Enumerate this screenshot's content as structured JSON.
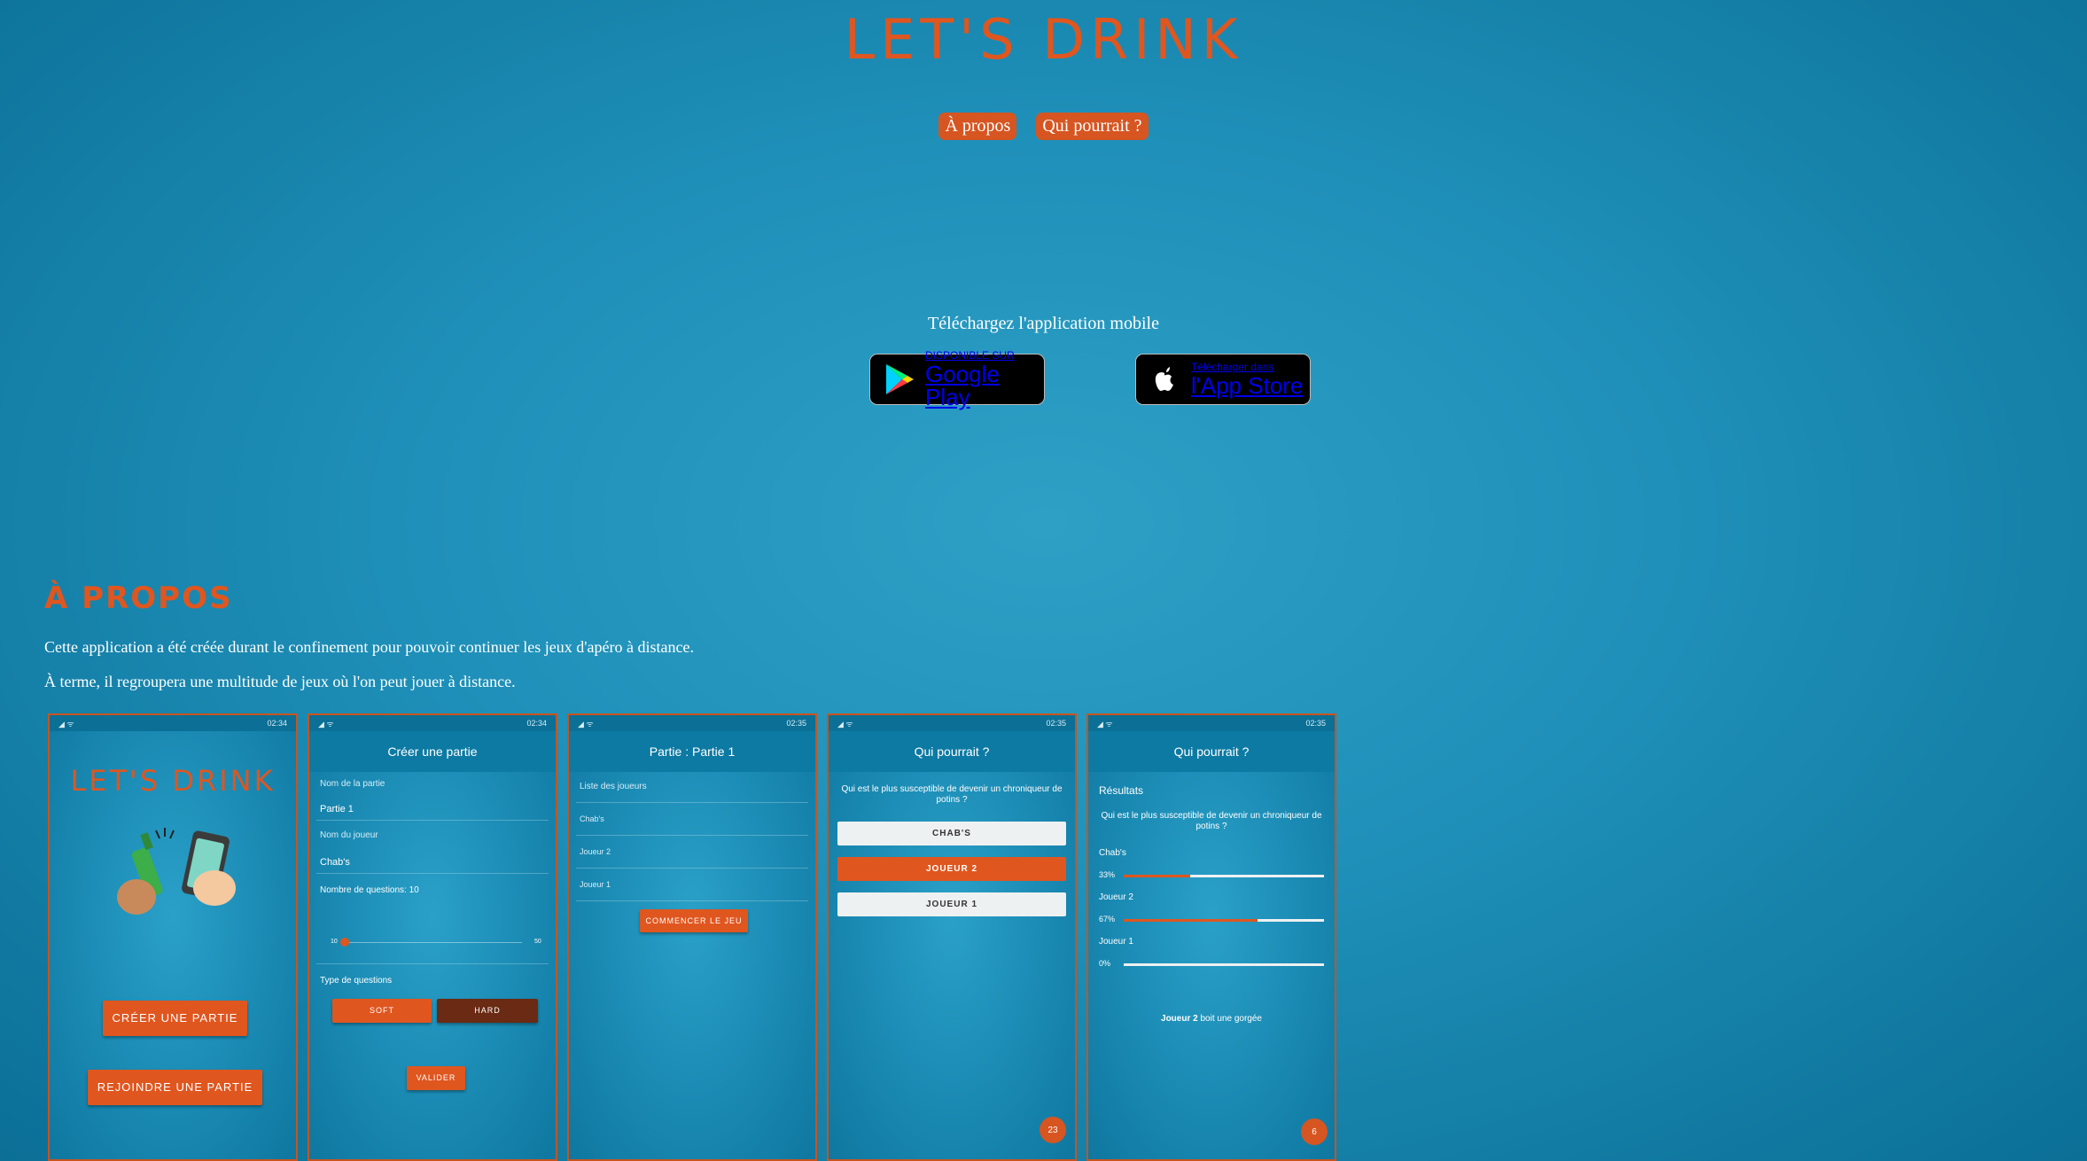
{
  "header": {
    "logo": "LET'S DRINK"
  },
  "nav": {
    "items": [
      {
        "label": "À propos"
      },
      {
        "label": "Qui pourrait ?"
      }
    ]
  },
  "download": {
    "title": "Téléchargez l'application mobile",
    "google": {
      "small": "DISPONIBLE SUR",
      "big": "Google Play",
      "icon": "google-play-icon"
    },
    "apple": {
      "small": "Télécharger dans",
      "big": "l'App Store",
      "icon": "apple-icon"
    }
  },
  "apropos": {
    "title": "À PROPOS",
    "p1": "Cette application a été créée durant le confinement pour pouvoir continuer les jeux d'apéro à distance.",
    "p2": "À terme, il regroupera une multitude de jeux où l'on peut jouer à distance."
  },
  "screens": {
    "s1": {
      "time": "02:34",
      "logo": "LET'S DRINK",
      "btn1": "CRÉER UNE PARTIE",
      "btn2": "REJOINDRE UNE PARTIE"
    },
    "s2": {
      "time": "02:34",
      "title": "Créer une partie",
      "name_label": "Nom de la partie",
      "name_value": "Partie 1",
      "player_label": "Nom du joueur",
      "player_value": "Chab's",
      "questions_label": "Nombre de questions: 10",
      "slider_min": "10",
      "slider_max": "50",
      "type_label": "Type de questions",
      "soft": "SOFT",
      "hard": "HARD",
      "validate": "VALIDER"
    },
    "s3": {
      "time": "02:35",
      "title": "Partie : Partie 1",
      "list_label": "Liste des joueurs",
      "players": [
        "Chab's",
        "Joueur 2",
        "Joueur 1"
      ],
      "start": "COMMENCER LE JEU"
    },
    "s4": {
      "time": "02:35",
      "title": "Qui pourrait ?",
      "question": "Qui est le plus susceptible de devenir un chroniqueur de potins ?",
      "options": [
        "CHAB'S",
        "JOUEUR 2",
        "JOUEUR 1"
      ],
      "badge": "23"
    },
    "s5": {
      "time": "02:35",
      "title": "Qui pourrait ?",
      "results_label": "Résultats",
      "question": "Qui est le plus susceptible de devenir un chroniqueur de potins ?",
      "results": [
        {
          "name": "Chab's",
          "pct": "33%",
          "value": 0.33
        },
        {
          "name": "Joueur 2",
          "pct": "67%",
          "value": 0.67
        },
        {
          "name": "Joueur 1",
          "pct": "0%",
          "value": 0
        }
      ],
      "drink_player": "Joueur 2",
      "drink_text": " boit une gorgée",
      "badge": "6"
    }
  },
  "colors": {
    "accent": "#e0561f",
    "background": "#1e8fb8"
  }
}
